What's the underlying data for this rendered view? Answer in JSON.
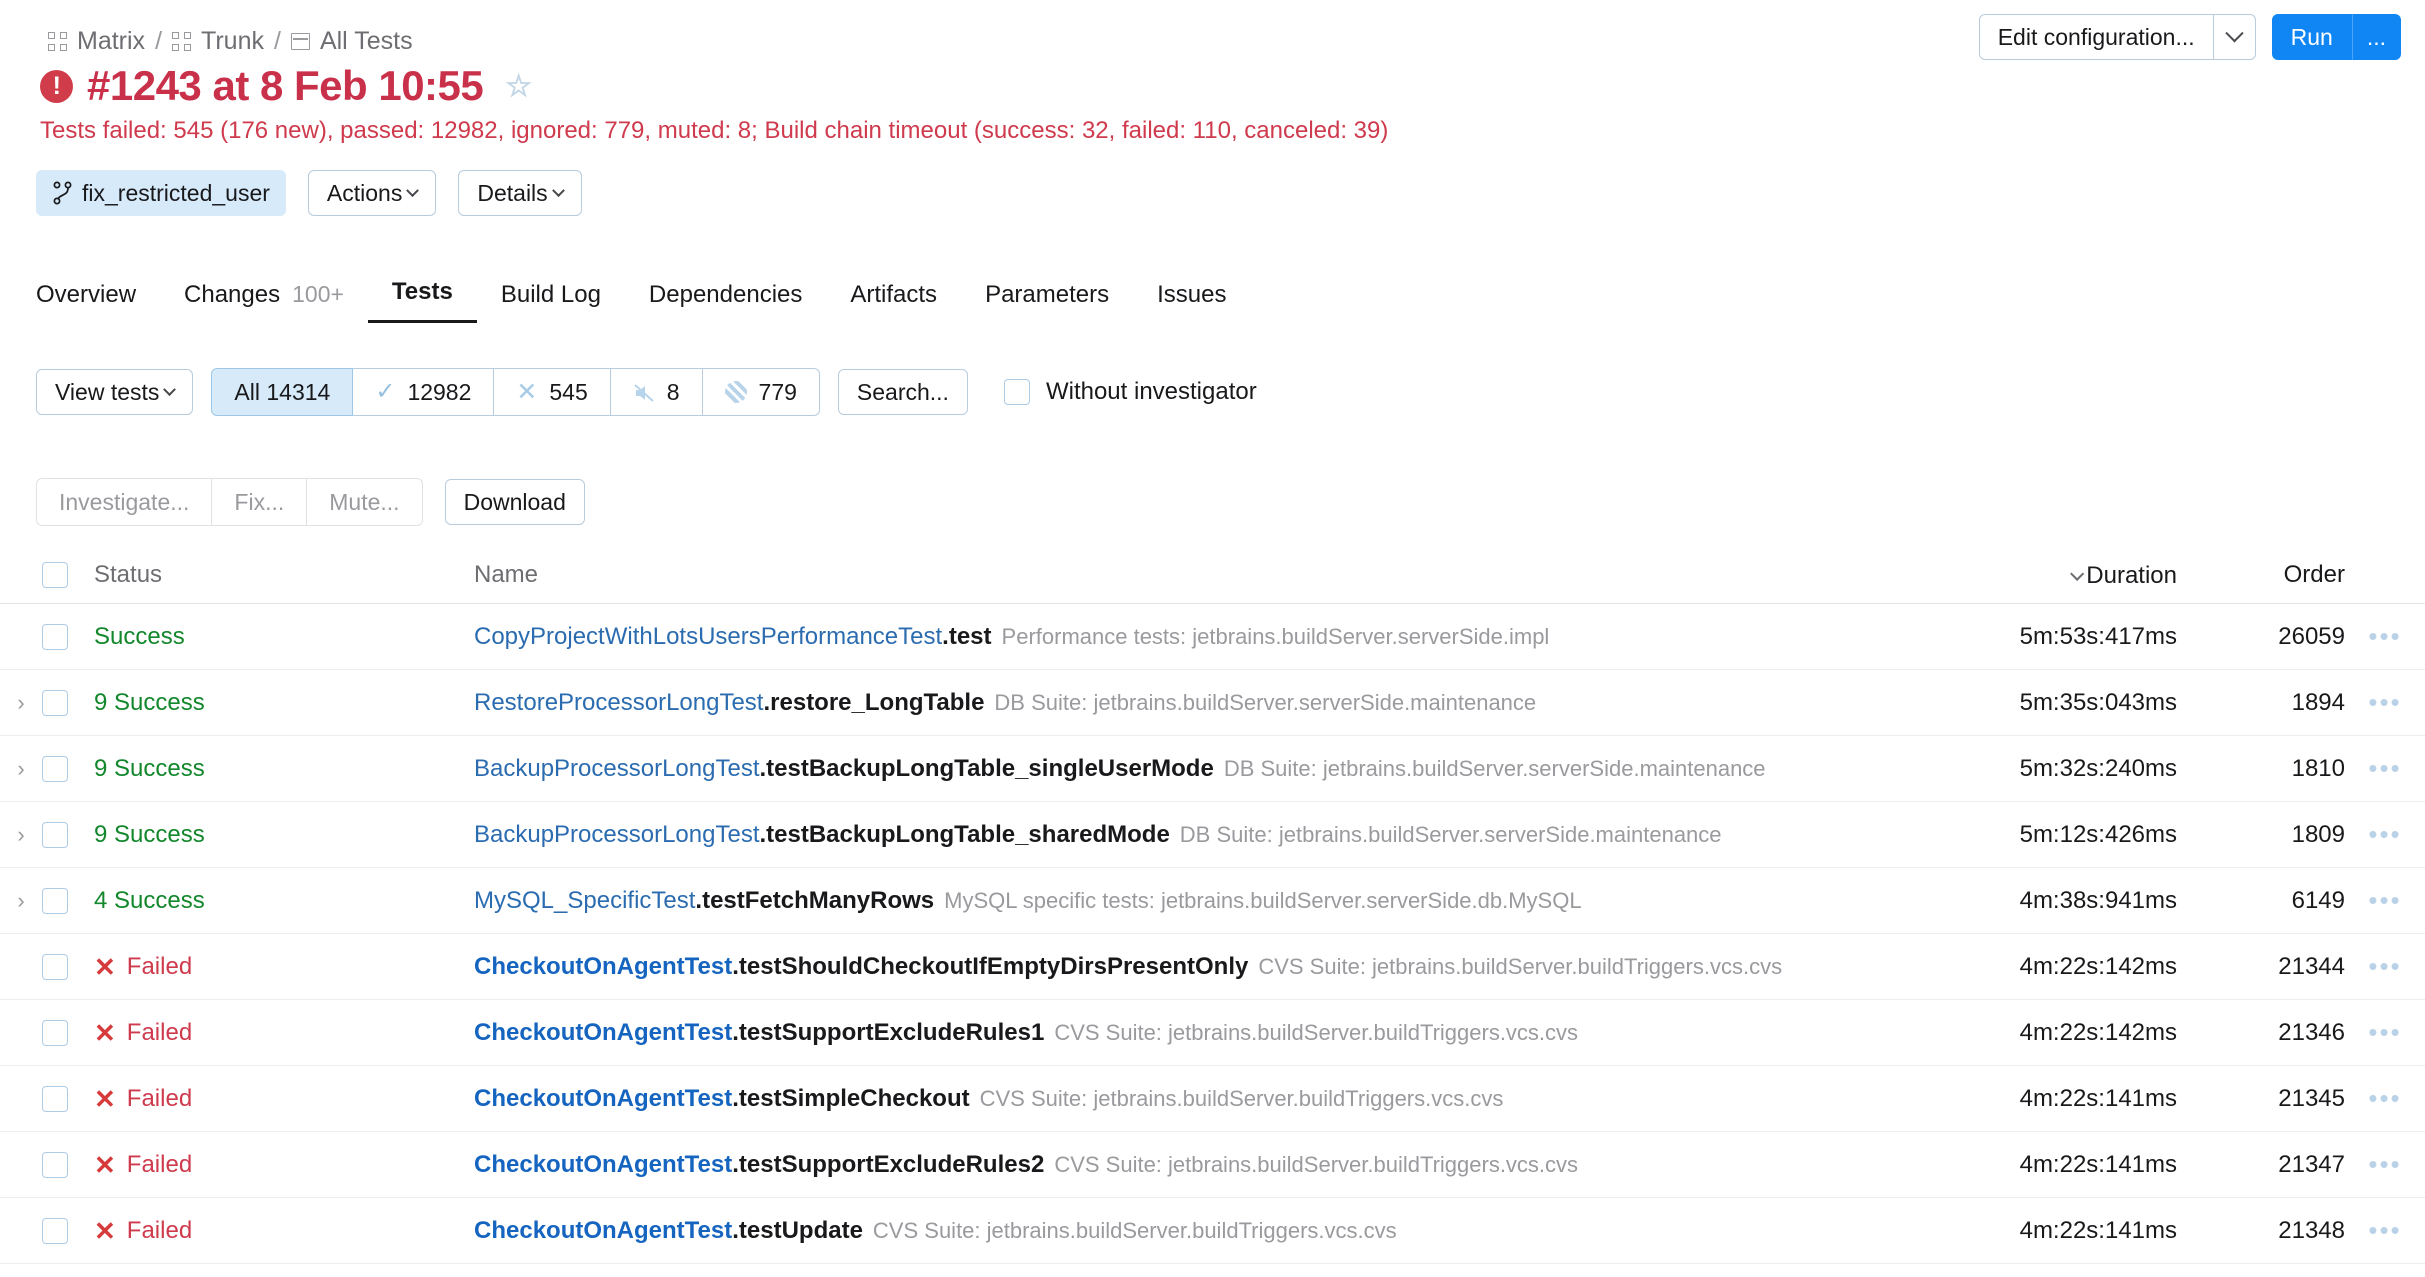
{
  "breadcrumb": [
    {
      "label": "Matrix",
      "icon": "grid-icon"
    },
    {
      "label": "Trunk",
      "icon": "grid-icon"
    },
    {
      "label": "All Tests",
      "icon": "board-icon"
    }
  ],
  "header": {
    "edit_config_label": "Edit configuration...",
    "run_label": "Run",
    "more_label": "..."
  },
  "build": {
    "title": "#1243 at 8 Feb 10:55",
    "error_glyph": "!",
    "status_line": "Tests failed: 545 (176 new), passed: 12982, ignored: 779, muted: 8; Build chain timeout (success: 32, failed: 110, canceled: 39)",
    "branch": "fix_restricted_user",
    "actions_label": "Actions",
    "details_label": "Details",
    "accent_red": "#cf3a4d"
  },
  "tabs": [
    {
      "label": "Overview",
      "count": "",
      "active": false
    },
    {
      "label": "Changes",
      "count": "100+",
      "active": false
    },
    {
      "label": "Tests",
      "count": "",
      "active": true
    },
    {
      "label": "Build Log",
      "count": "",
      "active": false
    },
    {
      "label": "Dependencies",
      "count": "",
      "active": false
    },
    {
      "label": "Artifacts",
      "count": "",
      "active": false
    },
    {
      "label": "Parameters",
      "count": "",
      "active": false
    },
    {
      "label": "Issues",
      "count": "",
      "active": false
    }
  ],
  "filters": {
    "view_tests_label": "View tests",
    "chips": [
      {
        "label": "All 14314",
        "icon": "",
        "selected": true
      },
      {
        "label": "12982",
        "icon": "check-icon",
        "selected": false
      },
      {
        "label": "545",
        "icon": "x-icon",
        "selected": false
      },
      {
        "label": "8",
        "icon": "mute-icon",
        "selected": false
      },
      {
        "label": "779",
        "icon": "ignored-icon",
        "selected": false
      }
    ],
    "search_label": "Search...",
    "without_investigator_label": "Without investigator"
  },
  "rowactions": {
    "investigate_label": "Investigate...",
    "fix_label": "Fix...",
    "mute_label": "Mute...",
    "download_label": "Download"
  },
  "table": {
    "columns": {
      "status": "Status",
      "name": "Name",
      "duration": "Duration",
      "order": "Order"
    },
    "rows": [
      {
        "expandable": false,
        "status": "Success",
        "status_type": "success",
        "status_count": "",
        "name_class": "CopyProjectWithLotsUsersPerformanceTest",
        "name_method": ".test",
        "suite": "Performance tests: jetbrains.buildServer.serverSide.impl",
        "duration": "5m:53s:417ms",
        "order": "26059"
      },
      {
        "expandable": true,
        "status": "Success",
        "status_type": "success",
        "status_count": "9",
        "name_class": "RestoreProcessorLongTest",
        "name_method": ".restore_LongTable",
        "suite": "DB Suite: jetbrains.buildServer.serverSide.maintenance",
        "duration": "5m:35s:043ms",
        "order": "1894"
      },
      {
        "expandable": true,
        "status": "Success",
        "status_type": "success",
        "status_count": "9",
        "name_class": "BackupProcessorLongTest",
        "name_method": ".testBackupLongTable_singleUserMode",
        "suite": "DB Suite: jetbrains.buildServer.serverSide.maintenance",
        "duration": "5m:32s:240ms",
        "order": "1810"
      },
      {
        "expandable": true,
        "status": "Success",
        "status_type": "success",
        "status_count": "9",
        "name_class": "BackupProcessorLongTest",
        "name_method": ".testBackupLongTable_sharedMode",
        "suite": "DB Suite: jetbrains.buildServer.serverSide.maintenance",
        "duration": "5m:12s:426ms",
        "order": "1809"
      },
      {
        "expandable": true,
        "status": "Success",
        "status_type": "success",
        "status_count": "4",
        "name_class": "MySQL_SpecificTest",
        "name_method": ".testFetchManyRows",
        "suite": "MySQL specific tests: jetbrains.buildServer.serverSide.db.MySQL",
        "duration": "4m:38s:941ms",
        "order": "6149"
      },
      {
        "expandable": false,
        "status": "Failed",
        "status_type": "failed",
        "status_count": "",
        "name_class": "CheckoutOnAgentTest",
        "name_method": ".testShouldCheckoutIfEmptyDirsPresentOnly",
        "suite": "CVS Suite: jetbrains.buildServer.buildTriggers.vcs.cvs",
        "duration": "4m:22s:142ms",
        "order": "21344"
      },
      {
        "expandable": false,
        "status": "Failed",
        "status_type": "failed",
        "status_count": "",
        "name_class": "CheckoutOnAgentTest",
        "name_method": ".testSupportExcludeRules1",
        "suite": "CVS Suite: jetbrains.buildServer.buildTriggers.vcs.cvs",
        "duration": "4m:22s:142ms",
        "order": "21346"
      },
      {
        "expandable": false,
        "status": "Failed",
        "status_type": "failed",
        "status_count": "",
        "name_class": "CheckoutOnAgentTest",
        "name_method": ".testSimpleCheckout",
        "suite": "CVS Suite: jetbrains.buildServer.buildTriggers.vcs.cvs",
        "duration": "4m:22s:141ms",
        "order": "21345"
      },
      {
        "expandable": false,
        "status": "Failed",
        "status_type": "failed",
        "status_count": "",
        "name_class": "CheckoutOnAgentTest",
        "name_method": ".testSupportExcludeRules2",
        "suite": "CVS Suite: jetbrains.buildServer.buildTriggers.vcs.cvs",
        "duration": "4m:22s:141ms",
        "order": "21347"
      },
      {
        "expandable": false,
        "status": "Failed",
        "status_type": "failed",
        "status_count": "",
        "name_class": "CheckoutOnAgentTest",
        "name_method": ".testUpdate",
        "suite": "CVS Suite: jetbrains.buildServer.buildTriggers.vcs.cvs",
        "duration": "4m:22s:141ms",
        "order": "21348"
      }
    ],
    "row_more_glyph": "•••",
    "expand_glyph": "›"
  }
}
